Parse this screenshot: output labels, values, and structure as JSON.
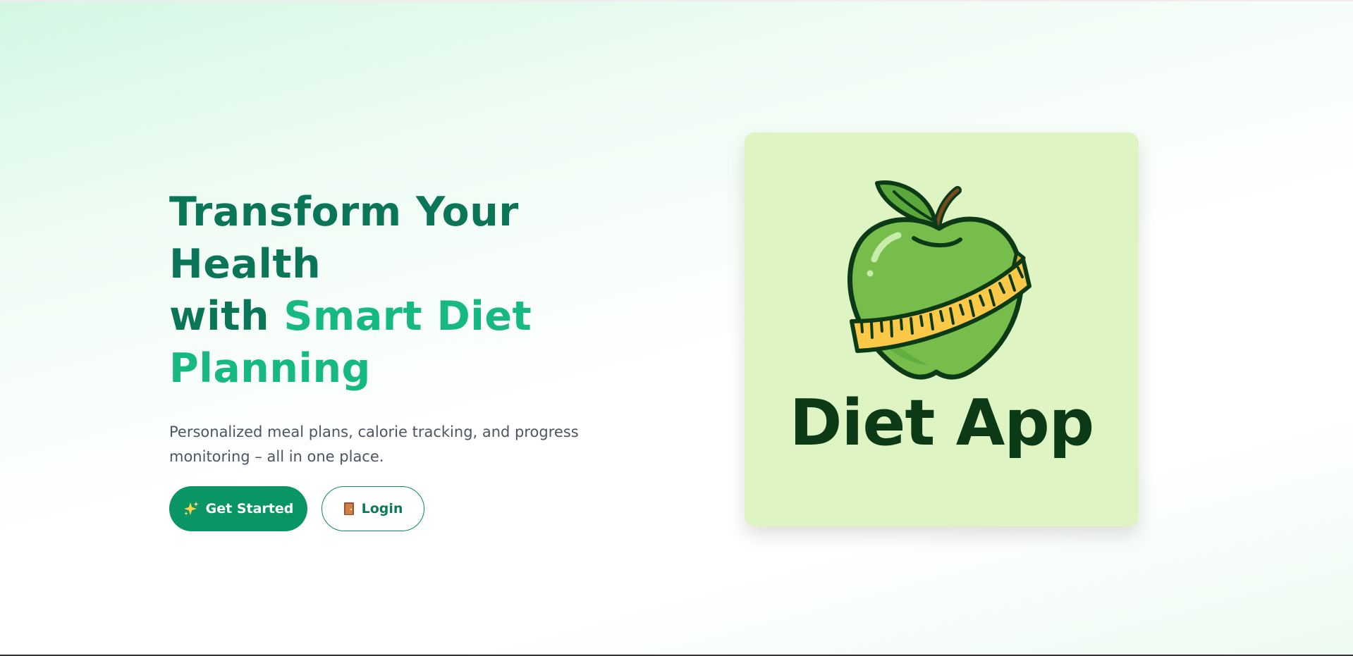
{
  "hero": {
    "title_line1": "Transform Your Health",
    "title_with": "with ",
    "title_accent_1": "Smart Diet",
    "title_accent_2": "Planning",
    "subtitle": "Personalized meal plans, calorie tracking, and progress monitoring – all in one place."
  },
  "cta": {
    "primary_label": "Get Started",
    "primary_icon": "sparkles-icon",
    "secondary_label": "Login",
    "secondary_icon": "door-icon"
  },
  "logo": {
    "text": "Diet App",
    "icon": "apple-measuring-tape-icon"
  },
  "colors": {
    "title_dark": "#0b7657",
    "title_accent": "#16b981",
    "primary_button": "#0a9565",
    "logo_card_bg": "#def5c3",
    "logo_text": "#0c3a16"
  }
}
